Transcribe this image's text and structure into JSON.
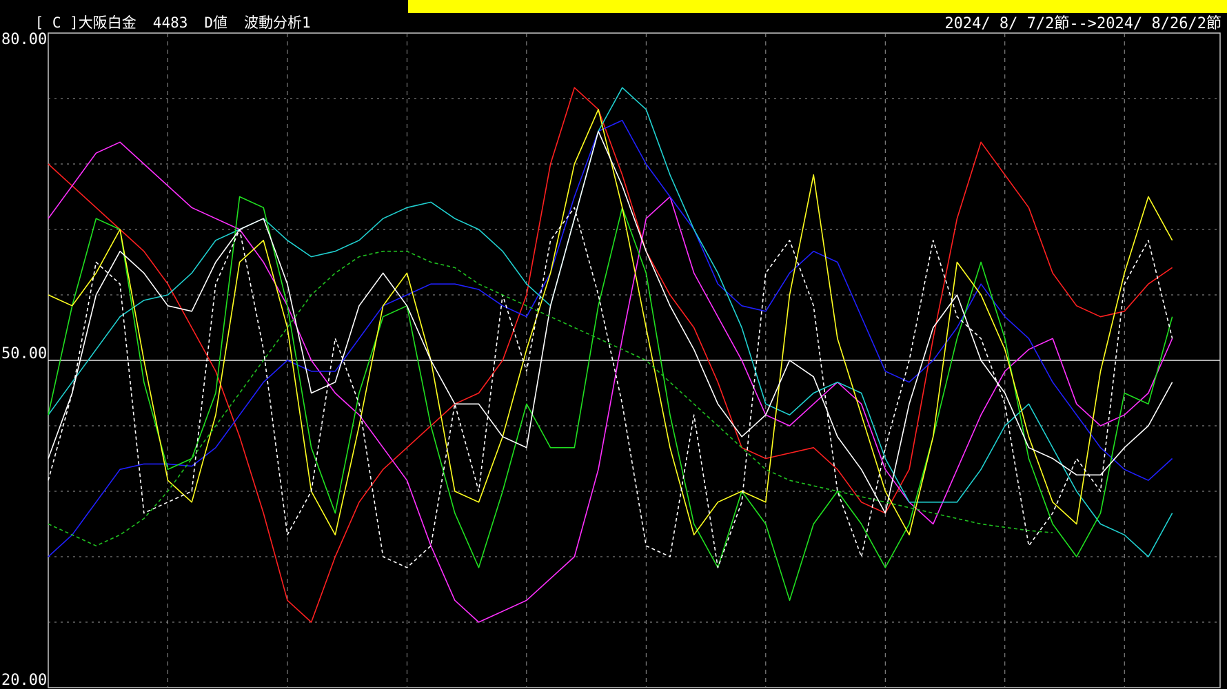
{
  "header": {
    "market": "[ C ]大阪白金",
    "code": "4483",
    "value_type": "D値",
    "analysis": "波動分析1",
    "highlight_color": "#ffff00"
  },
  "date_range": "2024/ 8/ 7/2節-->2024/ 8/26/2節",
  "chart_data": {
    "type": "line",
    "ylim": [
      20,
      80
    ],
    "ytick_labels": [
      "80.00",
      "50.00",
      "20.00"
    ],
    "reference_line": 50,
    "grid": true,
    "x": [
      0,
      1,
      2,
      3,
      4,
      5,
      6,
      7,
      8,
      9,
      10,
      11,
      12,
      13,
      14,
      15,
      16,
      17,
      18,
      19,
      20,
      21,
      22,
      23,
      24,
      25,
      26,
      27,
      28,
      29,
      30,
      31,
      32,
      33,
      34,
      35,
      36,
      37,
      38,
      39,
      40,
      41,
      42,
      43,
      44,
      45,
      46,
      47,
      48,
      49
    ],
    "series": [
      {
        "color": "#ff2020",
        "dashed": false,
        "values": [
          68,
          66,
          64,
          62,
          60,
          57,
          53,
          49,
          43,
          36,
          28,
          26,
          32,
          37,
          40,
          42,
          44,
          46,
          47,
          50,
          56,
          68,
          75,
          73,
          67,
          60,
          56,
          53,
          48,
          42,
          41,
          41.5,
          42,
          40,
          37,
          36,
          40,
          52,
          63,
          70,
          67,
          64,
          58,
          55,
          54,
          54.5,
          57,
          58.5,
          null,
          null
        ]
      },
      {
        "color": "#ff30ff",
        "dashed": false,
        "values": [
          63,
          66,
          69,
          70,
          68,
          66,
          64,
          63,
          62,
          59,
          55,
          50,
          47,
          45,
          42,
          39,
          33,
          28,
          26,
          27,
          28,
          30,
          32,
          40,
          52,
          63,
          65,
          58,
          54,
          50,
          45,
          44,
          46,
          48,
          46,
          40,
          37,
          35,
          40,
          45,
          49,
          51,
          52,
          46,
          44,
          45,
          47,
          52,
          null,
          null
        ]
      },
      {
        "color": "#2020ff",
        "dashed": false,
        "values": [
          32,
          34,
          37,
          40,
          40.5,
          40.5,
          40.3,
          42,
          45,
          48,
          50,
          49,
          49,
          52,
          55,
          56,
          57,
          57,
          56.5,
          55,
          54,
          58,
          65,
          71,
          72,
          68,
          65,
          62,
          57,
          55,
          54.5,
          58,
          60,
          59,
          54,
          49,
          48,
          50,
          53,
          57,
          54,
          52,
          48,
          45,
          42,
          40,
          39,
          41,
          null,
          null
        ]
      },
      {
        "color": "#20d0d0",
        "dashed": false,
        "values": [
          45,
          48,
          51,
          54,
          55.5,
          56,
          58,
          61,
          62,
          63,
          61,
          59.5,
          60,
          61,
          63,
          64,
          64.5,
          63,
          62,
          60,
          57,
          55,
          63,
          71,
          75,
          73,
          67,
          62,
          58,
          53,
          46,
          45,
          47,
          48,
          47,
          41,
          37,
          37,
          37,
          40,
          44,
          46,
          42,
          38,
          35,
          34,
          32,
          36,
          null,
          null
        ]
      },
      {
        "color": "#20e020",
        "dashed": false,
        "values": [
          45,
          55,
          63,
          62,
          48,
          40,
          41,
          47,
          65,
          64,
          55,
          42,
          36,
          47,
          54,
          55,
          44,
          36,
          31,
          38,
          46,
          42,
          42,
          55,
          64,
          58,
          45,
          35,
          31,
          38,
          35,
          28,
          35,
          38,
          35,
          31,
          35,
          43,
          52,
          59,
          52,
          41,
          35,
          32,
          36,
          47,
          46,
          54,
          null,
          null
        ]
      },
      {
        "color": "#ffff20",
        "dashed": false,
        "values": [
          56,
          55,
          58,
          62,
          50,
          39,
          37,
          45,
          59,
          61,
          53,
          38,
          34,
          44,
          55,
          58,
          50,
          38,
          37,
          43,
          51,
          58,
          68,
          73,
          64,
          53,
          42,
          34,
          37,
          38,
          37,
          56,
          67,
          52,
          45,
          38,
          34,
          43,
          59,
          56,
          51,
          43,
          37,
          35,
          49,
          58,
          65,
          61,
          null,
          null
        ]
      },
      {
        "color": "#ffffff",
        "dashed": false,
        "values": [
          41,
          47,
          56,
          60,
          58,
          55,
          54.5,
          59,
          62,
          63,
          57,
          47,
          48,
          55,
          58,
          55,
          50,
          46,
          46,
          43,
          42,
          55,
          63,
          71,
          66,
          60,
          55,
          51,
          46,
          43,
          45,
          50,
          48.5,
          43,
          40,
          36,
          46,
          53,
          56,
          50,
          47,
          42,
          41,
          39.5,
          39.5,
          42,
          44,
          48,
          null,
          null
        ]
      },
      {
        "color": "#ffffff",
        "dashed": true,
        "values": [
          39,
          47,
          59,
          57,
          36,
          37,
          38,
          57,
          62,
          51,
          34,
          38,
          52,
          46,
          32,
          31,
          33,
          46,
          38,
          56,
          49,
          61,
          64,
          56,
          46,
          33,
          32,
          45,
          31,
          37,
          58,
          61,
          55,
          38,
          32,
          42,
          50,
          61,
          54,
          52,
          46,
          33,
          36,
          41,
          38,
          57,
          61,
          52,
          null,
          null
        ]
      },
      {
        "color": "#20c020",
        "dashed": true,
        "values": [
          35,
          34,
          33,
          34,
          35.5,
          38,
          41,
          44,
          47,
          50,
          53,
          56,
          58,
          59.5,
          60,
          60,
          59,
          58.5,
          57,
          56,
          55,
          54,
          53,
          52,
          51,
          50,
          48,
          46,
          44,
          42,
          40,
          39,
          38.5,
          38,
          37.5,
          37,
          36.5,
          36,
          35.5,
          35,
          34.7,
          34.4,
          34.2,
          null,
          null,
          null,
          null,
          null,
          null,
          null
        ]
      }
    ]
  }
}
